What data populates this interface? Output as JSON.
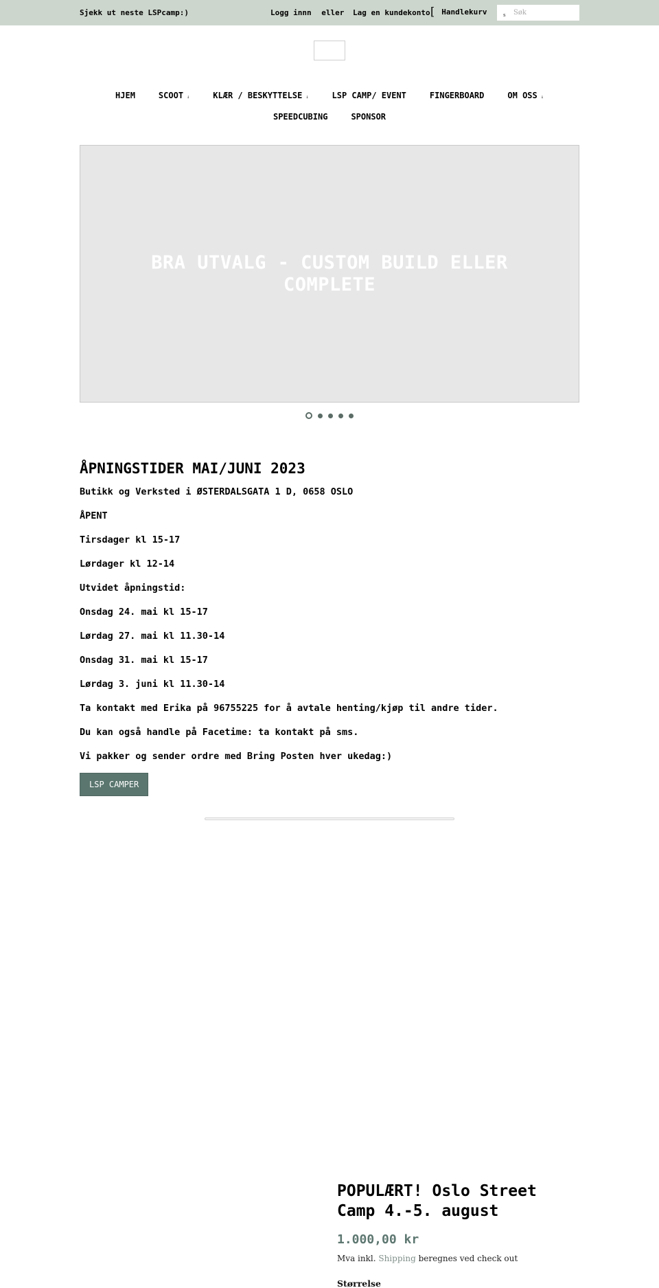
{
  "topbar": {
    "promo_link": "Sjekk ut neste LSPcamp:)",
    "login": "Logg innn",
    "or": "eller",
    "create_account": "Lag en kundekonto",
    "cart_icon": "[",
    "cart_label": "Handlekurv",
    "search_icon": "s",
    "search_placeholder": "Søk",
    "background_color": "#cdd6cd"
  },
  "logo": {
    "alt": ""
  },
  "nav": {
    "row1": [
      {
        "label": "HJEM",
        "has_dropdown": false
      },
      {
        "label": "SCOOT",
        "has_dropdown": true
      },
      {
        "label": "KLÆR / BESKYTTELSE",
        "has_dropdown": true
      },
      {
        "label": "LSP CAMP/ EVENT",
        "has_dropdown": false
      },
      {
        "label": "FINGERBOARD",
        "has_dropdown": false
      },
      {
        "label": "OM OSS",
        "has_dropdown": true
      }
    ],
    "row2": [
      {
        "label": "SPEEDCUBING",
        "has_dropdown": false
      },
      {
        "label": "SPONSOR",
        "has_dropdown": false
      }
    ],
    "dropdown_arrow": "↓"
  },
  "slideshow": {
    "caption": "BRA UTVALG - CUSTOM BUILD ELLER COMPLETE",
    "slide_count": 5,
    "active_slide": 1
  },
  "hours": {
    "title": "ÅPNINGSTIDER MAI/JUNI 2023",
    "lines": [
      "Butikk og Verksted i ØSTERDALSGATA 1 D, 0658 OSLO",
      "ÅPENT",
      "Tirsdager kl 15-17",
      "Lørdager kl 12-14",
      "Utvidet åpningstid:",
      "Onsdag 24. mai kl 15-17",
      "Lørdag 27. mai kl 11.30-14",
      "Onsdag 31. mai kl 15-17",
      "Lørdag 3. juni kl 11.30-14",
      "Ta kontakt med Erika på 96755225 for å avtale henting/kjøp til andre tider.",
      "Du kan også handle på Facetime: ta kontakt på sms.",
      "Vi pakker og sender ordre med Bring Posten hver ukedag:)"
    ],
    "button_label": "LSP CAMPER"
  },
  "product": {
    "title": "POPULÆRT! Oslo Street Camp 4.-5. august",
    "price": "1.000,00 kr",
    "tax_prefix": "Mva inkl.",
    "shipping_link": "Shipping",
    "tax_suffix": "beregnes ved check out",
    "size_label": "Størrelse"
  },
  "colors": {
    "accent": "#5a766e",
    "price": "#5d7770",
    "slide_bg": "#e7e7e7"
  }
}
